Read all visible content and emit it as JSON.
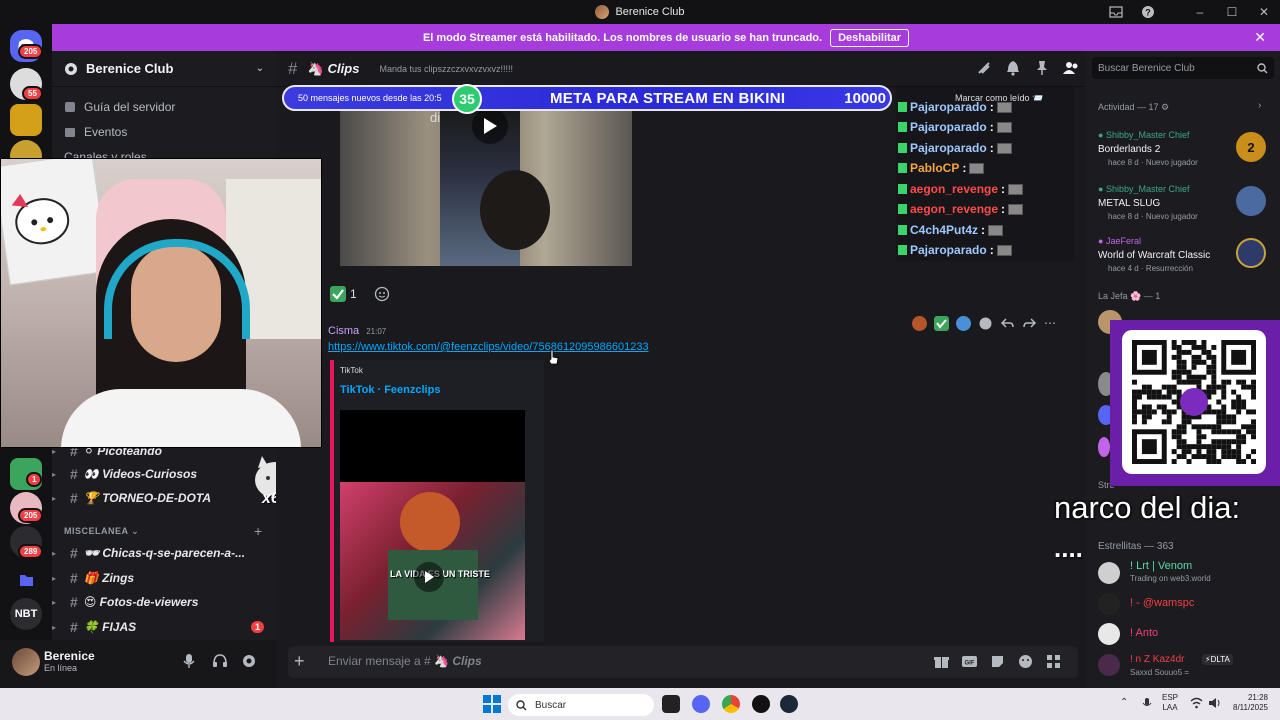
{
  "window": {
    "title": "Berenice Club"
  },
  "streamer_banner": {
    "text": "El modo Streamer está habilitado. Los nombres de usuario se han truncado.",
    "button": "Deshabilitar"
  },
  "server_rail": {
    "badges": [
      "205",
      "55",
      "1",
      "205",
      "289"
    ],
    "nbt_label": "NBT"
  },
  "sidebar": {
    "server_name": "Berenice Club",
    "items": [
      {
        "label": "Guía del servidor"
      },
      {
        "label": "Eventos"
      },
      {
        "label": "Canales y roles"
      }
    ],
    "channels_top": [
      {
        "emoji": "⚪",
        "name": "Picoteando"
      },
      {
        "emoji": "👀",
        "name": "Videos-Curiosos"
      },
      {
        "emoji": "🏆",
        "name": "TORNEO-DE-DOTA"
      }
    ],
    "category": "MISCELANEA",
    "channels_misc": [
      {
        "emoji": "🕶",
        "name": "Chicas-q-se-parecen-a-..."
      },
      {
        "emoji": "🎁",
        "name": "Zings"
      },
      {
        "emoji": "😍",
        "name": "Fotos-de-viewers"
      },
      {
        "emoji": "🍀",
        "name": "FIJAS",
        "unread": "1"
      }
    ],
    "overlay_x6": "x6"
  },
  "user_panel": {
    "name": "Berenice",
    "status": "En línea"
  },
  "chat_header": {
    "channel": "Clips",
    "topic": "Manda tus clipszzczxvxvzvxvz!!!!!"
  },
  "new_messages_bar": {
    "text": "50 mensajes nuevos desde las 20:5",
    "mark_read": "Marcar como leído"
  },
  "stream_goal": {
    "level": "35",
    "title": "META PARA STREAM EN BIKINI",
    "amount": "10000"
  },
  "messages": {
    "reaction_count": "1",
    "author": "Cisma",
    "time": "21:07",
    "link": "https://www.tiktok.com/@feenzclips/video/7568612095986601233",
    "embed_provider": "TikTok",
    "embed_title": "TikTok · Feenzclips",
    "video_caption_top": "dicie",
    "video_caption_bottom": "LA VIDA ES UN TRISTE"
  },
  "live_chat": [
    {
      "name": "Pajaroparado",
      "color": "#9fc8ff"
    },
    {
      "name": "Pajaroparado",
      "color": "#9fc8ff"
    },
    {
      "name": "Pajaroparado",
      "color": "#9fc8ff"
    },
    {
      "name": "PabloCP",
      "color": "#f5a442"
    },
    {
      "name": "aegon_revenge",
      "color": "#ff4a4a"
    },
    {
      "name": "aegon_revenge",
      "color": "#ff4a4a"
    },
    {
      "name": "C4ch4Put4z",
      "color": "#9fc8ff"
    },
    {
      "name": "Pajaroparado",
      "color": "#9fc8ff"
    }
  ],
  "members": {
    "search_placeholder": "Buscar Berenice Club",
    "activity_header": "Actividad — 17",
    "activities": [
      {
        "user": "Shibby_Master Chief",
        "game": "Borderlands 2",
        "ago": "hace 8 d",
        "tag": "Nuevo jugador"
      },
      {
        "user": "Shibby_Master Chief",
        "game": "METAL SLUG",
        "ago": "hace 8 d",
        "tag": "Nuevo jugador"
      },
      {
        "user": "JaeFeral",
        "game": "World of Warcraft Classic",
        "ago": "hace 4 d",
        "tag": "Resurrección"
      }
    ],
    "role_jefa": "La Jefa",
    "role_jefa_count": "— 1",
    "role_estrellitas": "Estrellitas — 363",
    "estrellitas": [
      {
        "name": "! Lrt | Venom",
        "sub": "Trading on web3.world",
        "color": "#57d9a3"
      },
      {
        "name": "! - @wamspc",
        "sub": "",
        "color": "#f23f7a"
      },
      {
        "name": "! Anto",
        "sub": "",
        "color": "#f23f7a"
      },
      {
        "name": "! n Z Kaz4dr",
        "sub": "Saxxd Souuo5 =",
        "color": "#f23f43",
        "tag": "DLTA"
      }
    ],
    "streaming_label": "Stre"
  },
  "overlay_text": {
    "line1": "narco del dia:",
    "line2": "...."
  },
  "chat_input": {
    "placeholder_prefix": "Enviar mensaje a #",
    "placeholder_channel": "Clips"
  },
  "taskbar": {
    "search": "Buscar",
    "lang": "ESP",
    "lang2": "LAA",
    "time": "21:28",
    "date": "8/11/2025"
  }
}
